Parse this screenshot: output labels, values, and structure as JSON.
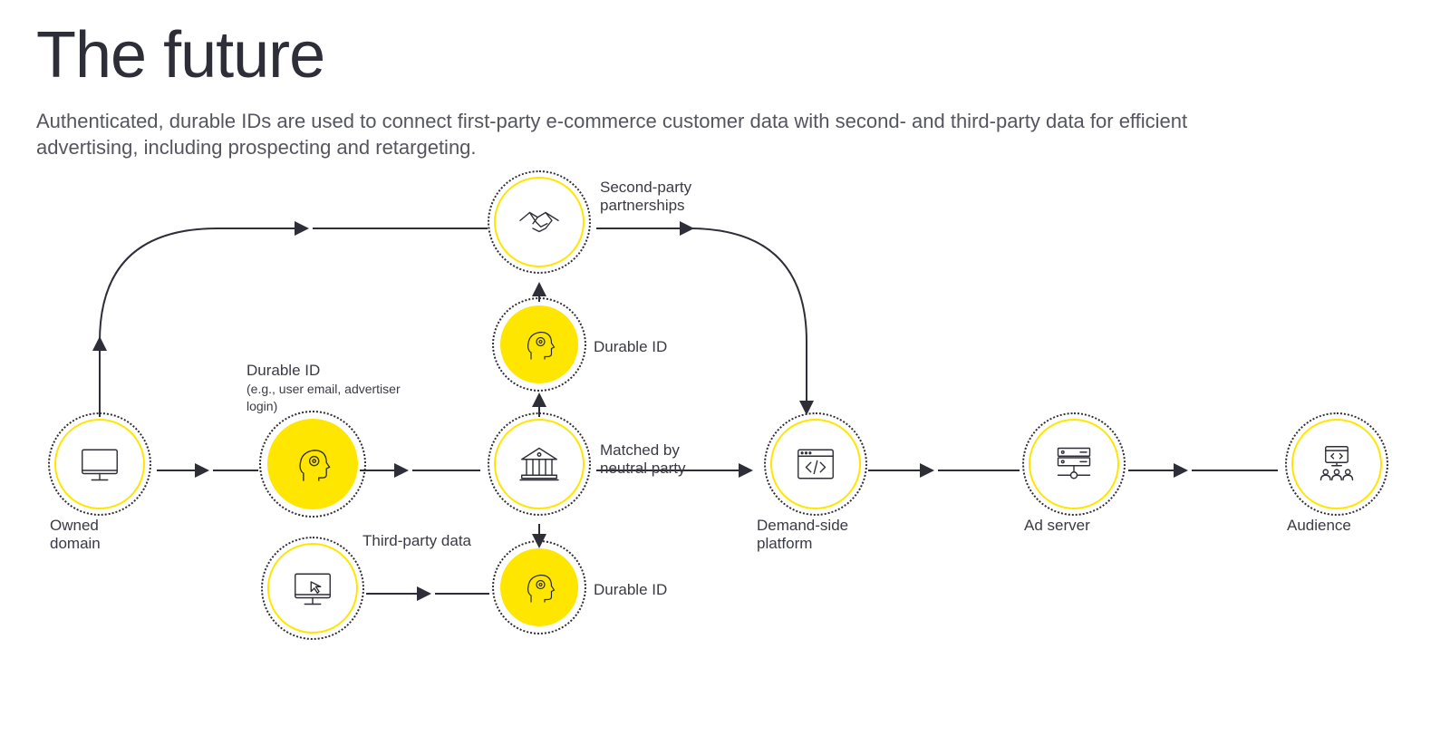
{
  "title": "The future",
  "subtitle": "Authenticated, durable IDs are used to connect first-party e-commerce customer data with second- and third-party data for efficient advertising, including prospecting and retargeting.",
  "nodes": {
    "owned_domain": {
      "label": "Owned domain"
    },
    "durable_id_main": {
      "label": "Durable ID",
      "sublabel": "(e.g., user email, advertiser login)"
    },
    "neutral_party": {
      "label": "Matched by neutral party"
    },
    "durable_id_up": {
      "label": "Durable ID"
    },
    "durable_id_down": {
      "label": "Durable ID"
    },
    "second_party": {
      "label": "Second-party partnerships"
    },
    "third_party": {
      "label": "Third-party data"
    },
    "dsp": {
      "label": "Demand-side platform"
    },
    "ad_server": {
      "label": "Ad server"
    },
    "audience": {
      "label": "Audience"
    }
  },
  "colors": {
    "accent": "#ffe600",
    "ink": "#2e2e38"
  }
}
